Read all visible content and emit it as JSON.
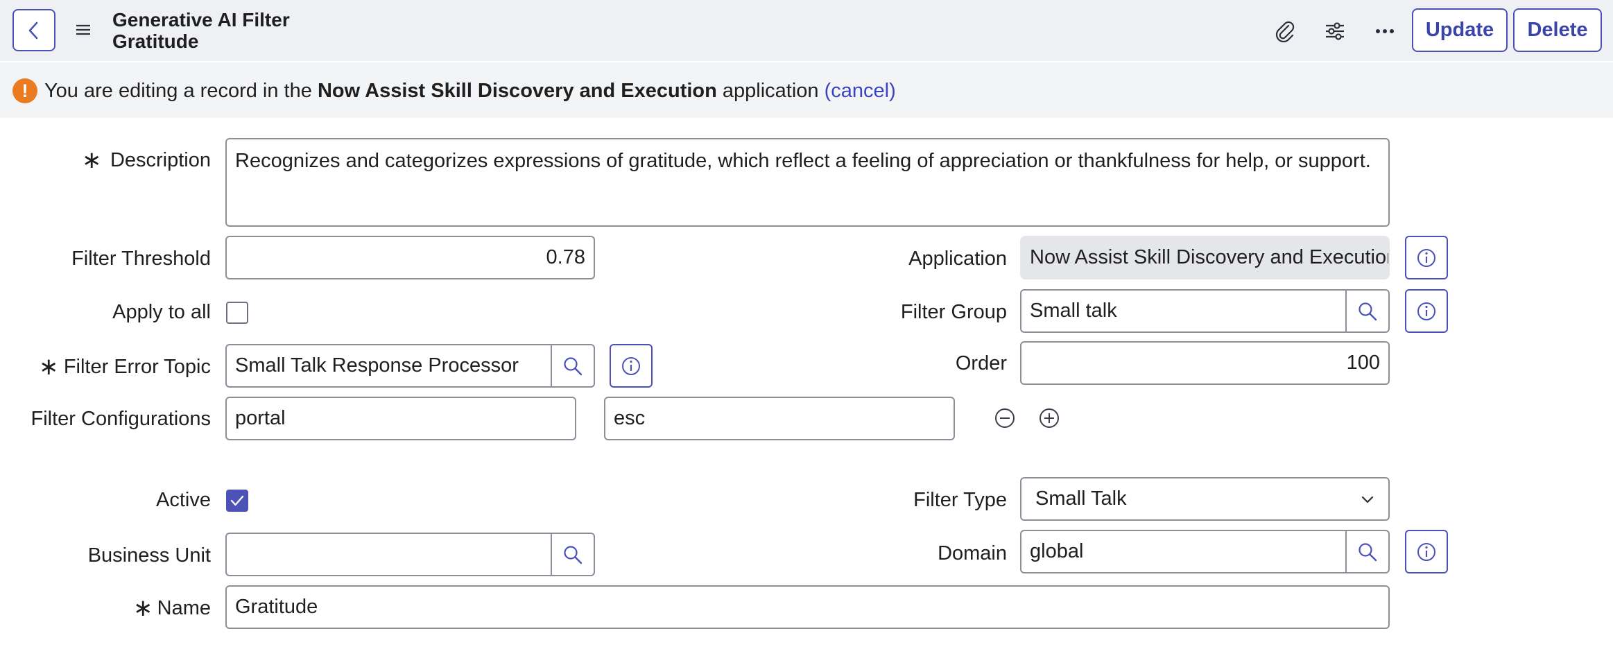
{
  "header": {
    "title_line1": "Generative AI Filter",
    "title_line2": "Gratitude",
    "update_label": "Update",
    "delete_label": "Delete",
    "icons": [
      "back-chevron-icon",
      "hamburger-menu-icon",
      "paperclip-icon",
      "sliders-icon",
      "more-options-icon"
    ]
  },
  "banner": {
    "prefix": "You are editing a record in the",
    "app_name": "Now Assist Skill Discovery and Execution",
    "suffix": "application",
    "cancel_link": "(cancel)",
    "icon": "warning-icon",
    "icon_glyph": "!"
  },
  "form": {
    "description": {
      "label": "Description",
      "required": true,
      "value": "Recognizes and categorizes expressions of gratitude, which reflect a feeling of appreciation or thankfulness for  help, or support."
    },
    "filter_threshold": {
      "label": "Filter Threshold",
      "value": "0.78"
    },
    "application": {
      "label": "Application",
      "value": "Now Assist Skill Discovery and Execution"
    },
    "apply_to_all": {
      "label": "Apply to all",
      "checked": false
    },
    "filter_group": {
      "label": "Filter Group",
      "value": "Small talk"
    },
    "filter_error_topic": {
      "label": "Filter Error Topic",
      "required": true,
      "value": "Small Talk Response Processor"
    },
    "order": {
      "label": "Order",
      "value": "100"
    },
    "filter_configurations": {
      "label": "Filter Configurations",
      "values": [
        "portal",
        "esc"
      ]
    },
    "active": {
      "label": "Active",
      "checked": true
    },
    "filter_type": {
      "label": "Filter Type",
      "value": "Small Talk"
    },
    "business_unit": {
      "label": "Business Unit",
      "value": ""
    },
    "domain": {
      "label": "Domain",
      "value": "global"
    },
    "name": {
      "label": "Name",
      "required": true,
      "value": "Gratitude"
    },
    "required_marker": "∗"
  },
  "colors": {
    "accent": "#4a52b8",
    "warning": "#ea7b21",
    "link": "#3b44c0",
    "header_bg": "#eef0f3",
    "banner_bg": "#f3f4f6",
    "readonly_bg": "#e4e6ea"
  }
}
